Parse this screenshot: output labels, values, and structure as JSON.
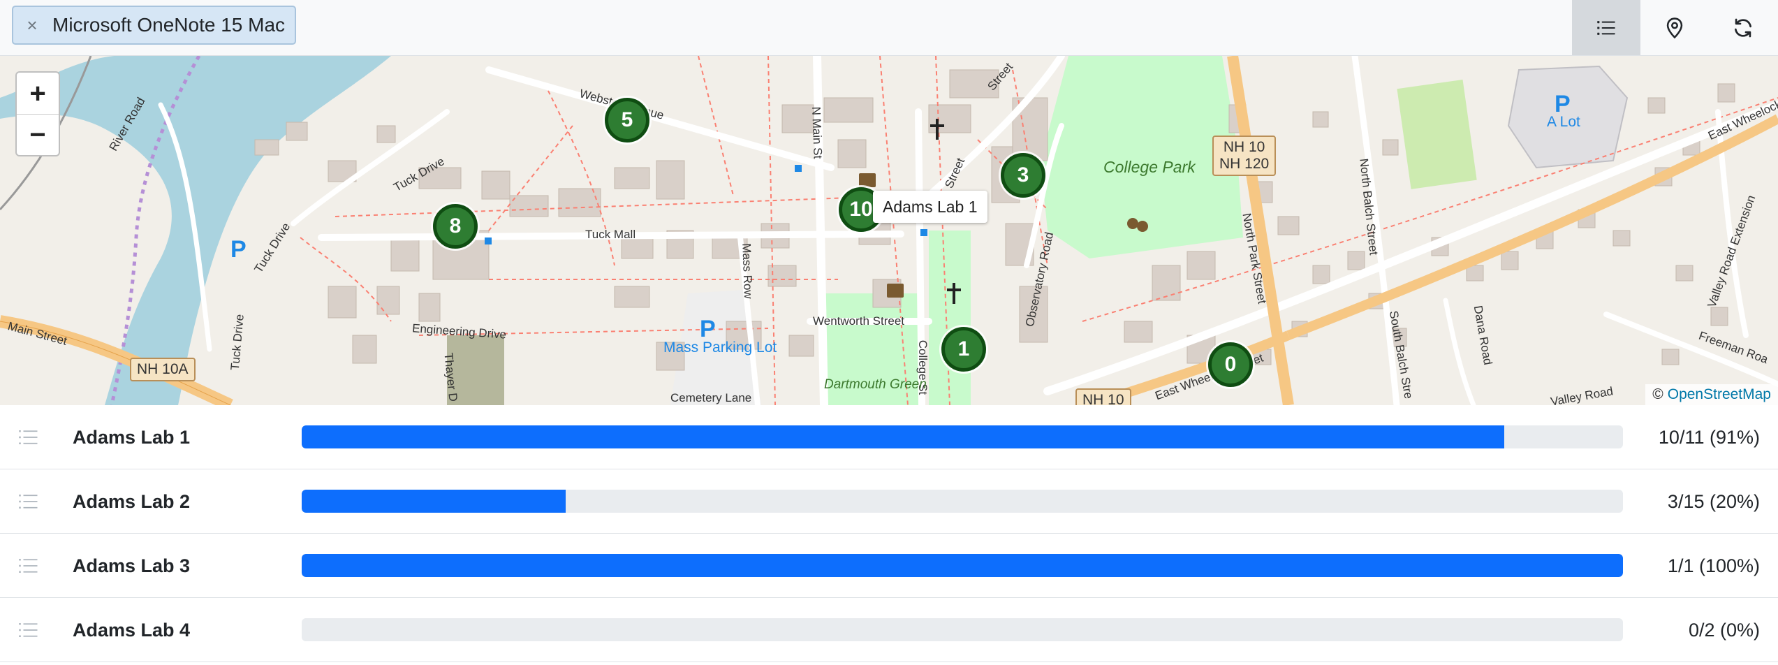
{
  "filter": {
    "label": "Microsoft OneNote 15 Mac",
    "close_glyph": "×"
  },
  "toolbar": {
    "buttons": [
      {
        "name": "list-view",
        "icon": "list-icon",
        "active": true
      },
      {
        "name": "map-view",
        "icon": "map-pin-icon",
        "active": false
      },
      {
        "name": "refresh",
        "icon": "refresh-icon",
        "active": false
      }
    ]
  },
  "map": {
    "zoom_in": "+",
    "zoom_out": "−",
    "attribution_prefix": "©",
    "attribution_link": "OpenStreetMap",
    "tooltip": "Adams Lab 1",
    "markers": [
      "5",
      "3",
      "8",
      "10",
      "1",
      "0"
    ],
    "labels": {
      "river_road": "River Road",
      "webster_avenue": "Webster Avenue",
      "tuck_drive": "Tuck Drive",
      "tuck_drive_2": "Tuck Drive",
      "tuck_drive_3": "Tuck Drive",
      "tuck_mall": "Tuck Mall",
      "main_street": "Main Street",
      "nh_10a": "NH 10A",
      "engineering_drive": "Engineering Drive",
      "thayer_drive": "Thayer D",
      "mass_row": "Mass Row",
      "n_main_street": "N Main St",
      "mass_parking_lot": "Mass Parking Lot",
      "wentworth_street": "Wentworth Street",
      "college_street": "College St",
      "college_street_2": "Street",
      "cemetery_lane": "Cemetery Lane",
      "dartmouth_green": "Dartmouth Green",
      "observatory_road": "Observatory Road",
      "college_park": "College Park",
      "nh_10_nh_120": "NH 10\nNH 120",
      "north_park_street": "North Park Street",
      "north_balch_street": "North Balch Street",
      "south_balch_street": "South Balch Stre",
      "dana_road": "Dana Road",
      "east_wheelock": "East Wheelock",
      "east_wheelock_street": "East Wheelock Street",
      "valley_road_ext": "Valley Road Extension",
      "valley_road": "Valley Road",
      "freeman_road": "Freeman Roa",
      "a_lot_p": "P",
      "a_lot": "A Lot",
      "parking_p": "P",
      "mass_p": "P",
      "nh_10": "NH 10",
      "street_top": "Street"
    }
  },
  "rows": [
    {
      "name": "Adams Lab 1",
      "stat": "10/11 (91%)",
      "progress": 0.91
    },
    {
      "name": "Adams Lab 2",
      "stat": "3/15 (20%)",
      "progress": 0.2
    },
    {
      "name": "Adams Lab 3",
      "stat": "1/1 (100%)",
      "progress": 1.0
    },
    {
      "name": "Adams Lab 4",
      "stat": "0/2 (0%)",
      "progress": 0.0
    }
  ],
  "colors": {
    "bar_fill": "#0d6efd",
    "bar_track": "#e9ecef",
    "marker_fill": "#2e7d32",
    "water": "#aad3df",
    "park": "#c8facc"
  }
}
